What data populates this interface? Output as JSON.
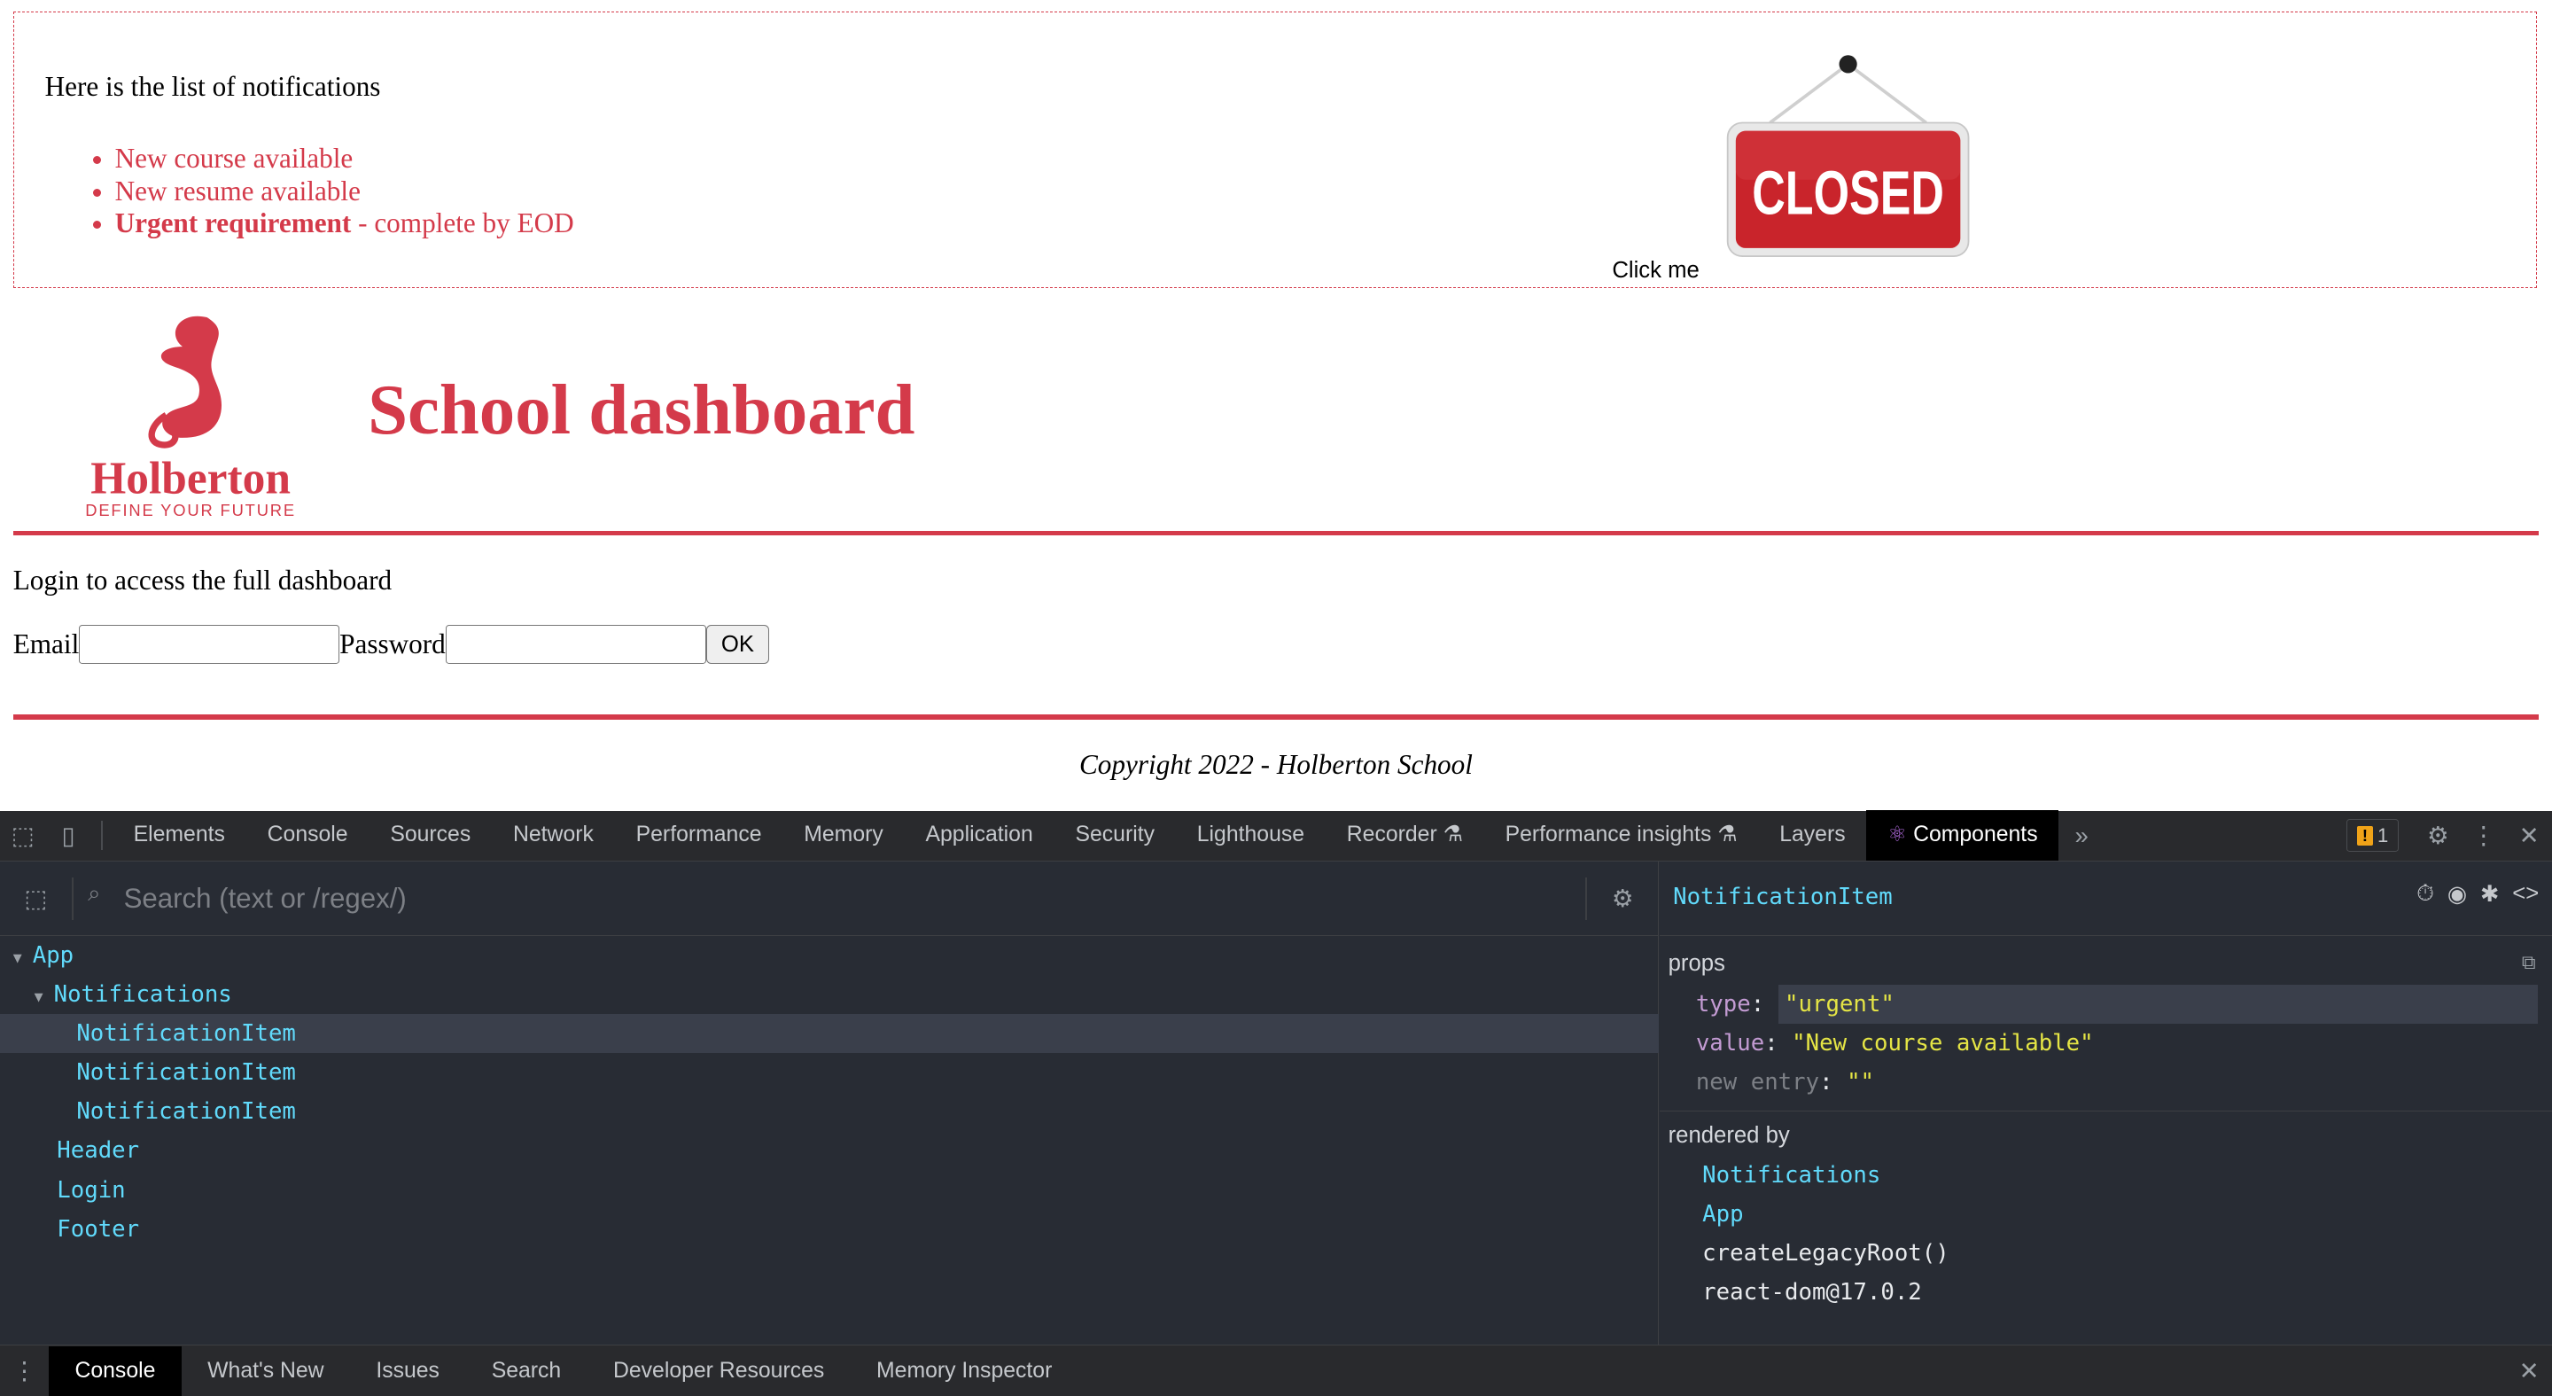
{
  "page": {
    "notifications": {
      "title": "Here is the list of notifications",
      "items": [
        {
          "text": "New course available",
          "bold": ""
        },
        {
          "text": "New resume available",
          "bold": ""
        },
        {
          "text": " - complete by EOD",
          "bold": "Urgent requirement"
        }
      ],
      "sign_text": "CLOSED",
      "click_label": "Click me"
    },
    "header": {
      "logo_name": "Holberton",
      "logo_tagline": "DEFINE YOUR FUTURE",
      "title": "School dashboard"
    },
    "login": {
      "intro": "Login to access the full dashboard",
      "email_label": "Email",
      "password_label": "Password",
      "ok_label": "OK"
    },
    "footer": {
      "copyright": "Copyright 2022 - Holberton School"
    },
    "colors": {
      "brand_red": "#d43a4a",
      "react_cyan": "#61dafb"
    }
  },
  "devtools": {
    "tabs": [
      "Elements",
      "Console",
      "Sources",
      "Network",
      "Performance",
      "Memory",
      "Application",
      "Security",
      "Lighthouse",
      "Recorder",
      "Performance insights",
      "Layers",
      "Components"
    ],
    "active_tab": "Components",
    "warning_count": "1",
    "search_placeholder": "Search (text or /regex/)",
    "tree": [
      {
        "label": "App",
        "indent": 0,
        "expanded": true,
        "selected": false
      },
      {
        "label": "Notifications",
        "indent": 1,
        "expanded": true,
        "selected": false
      },
      {
        "label": "NotificationItem",
        "indent": 2,
        "expanded": false,
        "selected": true
      },
      {
        "label": "NotificationItem",
        "indent": 2,
        "expanded": false,
        "selected": false
      },
      {
        "label": "NotificationItem",
        "indent": 2,
        "expanded": false,
        "selected": false
      },
      {
        "label": "Header",
        "indent": 1,
        "expanded": false,
        "selected": false
      },
      {
        "label": "Login",
        "indent": 1,
        "expanded": false,
        "selected": false
      },
      {
        "label": "Footer",
        "indent": 1,
        "expanded": false,
        "selected": false
      }
    ],
    "selected_component": "NotificationItem",
    "props_label": "props",
    "props": [
      {
        "key": "type",
        "value": "\"urgent\"",
        "editing": true
      },
      {
        "key": "value",
        "value": "\"New course available\"",
        "editing": false
      }
    ],
    "new_entry": {
      "key": "new entry",
      "value": "\"\""
    },
    "rendered_by_label": "rendered by",
    "rendered_by": [
      {
        "label": "Notifications",
        "component": true
      },
      {
        "label": "App",
        "component": true
      },
      {
        "label": "createLegacyRoot()",
        "component": false
      },
      {
        "label": "react-dom@17.0.2",
        "component": false
      }
    ],
    "drawer_tabs": [
      "Console",
      "What's New",
      "Issues",
      "Search",
      "Developer Resources",
      "Memory Inspector"
    ],
    "drawer_active": "Console"
  }
}
